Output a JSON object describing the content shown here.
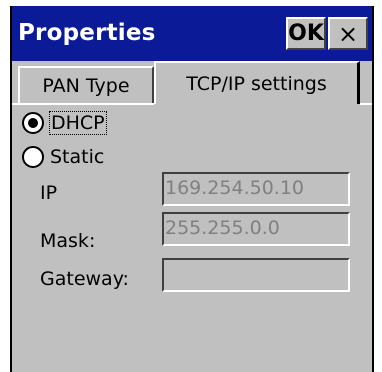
{
  "window": {
    "title": "Properties",
    "ok_label": "OK",
    "close_label": "×"
  },
  "tabs": [
    {
      "label": "PAN Type",
      "selected": false
    },
    {
      "label": "TCP/IP settings",
      "selected": true
    }
  ],
  "addressing": {
    "dhcp_label": "DHCP",
    "static_label": "Static",
    "selected": "DHCP"
  },
  "fields": {
    "ip": {
      "label": "IP",
      "value": "169.254.50.10"
    },
    "mask": {
      "label": "Mask:",
      "value": "255.255.0.0"
    },
    "gateway": {
      "label": "Gateway:",
      "value": ""
    }
  },
  "colors": {
    "titlebar": "#0b1b97",
    "face": "#c0c0c0",
    "disabled_text": "#808080"
  }
}
